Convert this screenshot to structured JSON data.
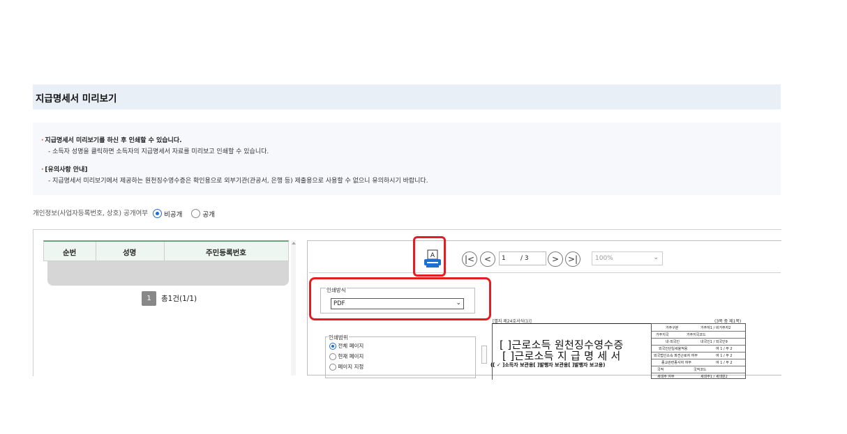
{
  "header": {
    "title": "지급명세서 미리보기"
  },
  "notice": {
    "line1": "지급명세서 미리보기를 하신 후 인쇄할 수 있습니다.",
    "line2": "- 소득자 성명을 클릭하면 소득자의 지급명세서 자료를 미리보고 인쇄할 수 있습니다.",
    "line3": "[유의사항 안내]",
    "line4": "- 지급명세서 미리보기에서 제공하는 원천징수영수증은 확인용으로 외부기관(관공서, 은행 등) 제출용으로 사용할 수 없으니 유의하시기 바랍니다."
  },
  "privacy": {
    "label": "개인정보(사업자등록번호, 상호) 공개여부",
    "options": [
      {
        "label": "비공개",
        "selected": true
      },
      {
        "label": "공개",
        "selected": false
      }
    ]
  },
  "table": {
    "columns": [
      "순번",
      "성명",
      "주민등록번호"
    ],
    "rows": [],
    "pagination": {
      "current": "1",
      "summary": "총1건(1/1)"
    }
  },
  "viewer": {
    "toolbar": {
      "print_icon": "printer-icon",
      "first": "|<",
      "prev": "<",
      "next": ">",
      "last": ">|",
      "page_value": "1",
      "page_total": "/ 3",
      "zoom_value": "100%"
    },
    "print_method": {
      "legend": "인쇄방식",
      "value": "PDF"
    },
    "print_range": {
      "legend": "인쇄범위",
      "options": [
        {
          "label": "전체 페이지",
          "selected": true
        },
        {
          "label": "현재 페이지",
          "selected": false
        },
        {
          "label": "페이지 지정",
          "selected": false
        }
      ]
    },
    "document": {
      "form_no": "[별지 제24호서식(1)]",
      "page_info": "(3쪽 중 제1쪽)",
      "title1": "[ ]근로소득 원천징수영수증",
      "title2": "[ ]근로소득 지 급 명 세 서",
      "subtitle": "([ ✓ ]소득자 보관용[    ]발행자 보관용[    ]발행자 보고용)",
      "grid": [
        [
          "거주구분",
          "거주자1 / 비거주자2"
        ],
        [
          "거주지국",
          "거주지국코드"
        ],
        [
          "내·외국인",
          "내국인1 / 외국인9"
        ],
        [
          "외국인단일세율적용",
          "여 1 / 부 2"
        ],
        [
          "외국법인소속 파견근로자 여부",
          "여 1 / 부 2"
        ],
        [
          "종교관련종사자 여부",
          "여 1 / 부 2"
        ],
        [
          "국적",
          "국적코드"
        ],
        [
          "세대주 여부",
          "세대주1 / 세대원2"
        ]
      ]
    }
  },
  "colors": {
    "title_bg": "#e9eff6",
    "notice_bg": "#f6f8fb",
    "highlight": "#e41e1e",
    "radio": "#1f6bd6"
  }
}
